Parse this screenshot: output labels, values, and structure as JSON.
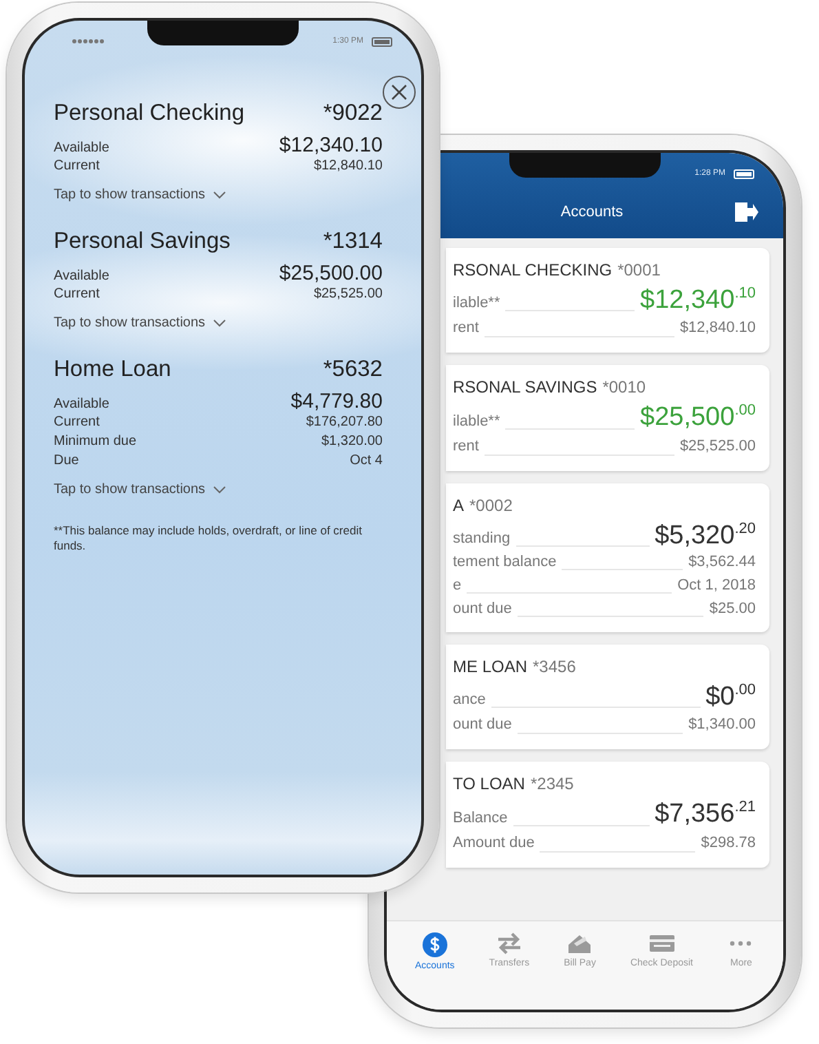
{
  "front_phone": {
    "status_bar": {
      "time": "1:30 PM"
    },
    "accounts": [
      {
        "name": "Personal Checking",
        "number": "*9022",
        "rows": [
          {
            "label": "Available",
            "value": "$12,340.10",
            "kind": "primary"
          },
          {
            "label": "Current",
            "value": "$12,840.10",
            "kind": "secondary"
          }
        ],
        "toggle": "Tap to show transactions"
      },
      {
        "name": "Personal Savings",
        "number": "*1314",
        "rows": [
          {
            "label": "Available",
            "value": "$25,500.00",
            "kind": "primary"
          },
          {
            "label": "Current",
            "value": "$25,525.00",
            "kind": "secondary"
          }
        ],
        "toggle": "Tap to show transactions"
      },
      {
        "name": "Home Loan",
        "number": "*5632",
        "rows": [
          {
            "label": "Available",
            "value": "$4,779.80",
            "kind": "primary"
          },
          {
            "label": "Current",
            "value": "$176,207.80",
            "kind": "secondary"
          },
          {
            "label": "Minimum due",
            "value": "$1,320.00",
            "kind": "secondary"
          },
          {
            "label": "Due",
            "value": "Oct 4",
            "kind": "secondary"
          }
        ],
        "toggle": "Tap to show transactions"
      }
    ],
    "footnote": "**This balance may include holds, overdraft, or line of credit funds."
  },
  "back_phone": {
    "status_bar": {
      "time": "1:28 PM"
    },
    "header": {
      "title": "Accounts"
    },
    "cards": [
      {
        "title": "RSONAL CHECKING",
        "number": "*0001",
        "rows": [
          {
            "label": "ilable**",
            "value": "$12,340$^{.10}$",
            "kind": "primary",
            "color": "#3ca23c"
          },
          {
            "label": "rent",
            "value": "$12,840.10",
            "kind": "secondary"
          }
        ]
      },
      {
        "title": "RSONAL SAVINGS",
        "number": "*0010",
        "rows": [
          {
            "label": "ilable**",
            "value": "$25,500$^{.00}$",
            "kind": "primary",
            "color": "#3ca23c"
          },
          {
            "label": "rent",
            "value": "$25,525.00",
            "kind": "secondary"
          }
        ]
      },
      {
        "title": "A",
        "number": "*0002",
        "rows": [
          {
            "label": "standing",
            "value": "$5,320$^{.20}$",
            "kind": "primary",
            "color": "#333333"
          },
          {
            "label": "tement balance",
            "value": "$3,562.44",
            "kind": "secondary"
          },
          {
            "label": "e",
            "value": "Oct 1, 2018",
            "kind": "secondary"
          },
          {
            "label": "ount due",
            "value": "$25.00",
            "kind": "secondary"
          }
        ]
      },
      {
        "title": "ME LOAN",
        "number": "*3456",
        "rows": [
          {
            "label": "ance",
            "value": "$0$^{.00}$",
            "kind": "primary",
            "color": "#333333"
          },
          {
            "label": "ount due",
            "value": "$1,340.00",
            "kind": "secondary"
          }
        ]
      },
      {
        "title": "TO LOAN",
        "number": "*2345",
        "rows": [
          {
            "label": "Balance",
            "value": "$7,356$^{.21}$",
            "kind": "primary",
            "color": "#333333"
          },
          {
            "label": "Amount due",
            "value": "$298.78",
            "kind": "secondary"
          }
        ]
      }
    ],
    "tab_bar": [
      {
        "label": "Accounts",
        "selected": true
      },
      {
        "label": "Transfers",
        "selected": false
      },
      {
        "label": "Bill Pay",
        "selected": false
      },
      {
        "label": "Check Deposit",
        "selected": false
      },
      {
        "label": "More",
        "selected": false
      }
    ]
  }
}
